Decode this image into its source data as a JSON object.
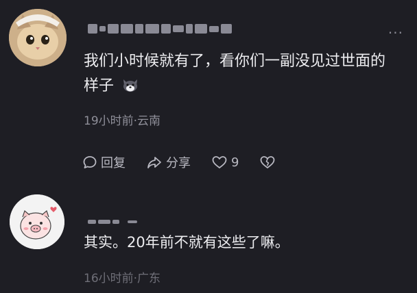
{
  "comments": [
    {
      "text": "我们小时候就有了，看你们一副没见过世面的样子",
      "emoji": "husky-face",
      "time": "19小时前",
      "location": "云南",
      "actions": {
        "reply": "回复",
        "share": "分享",
        "likes": "9"
      }
    },
    {
      "text": "其实。20年前不就有这些了嘛。",
      "time": "16小时前",
      "location": "广东"
    }
  ],
  "separator": "·",
  "colors": {
    "background": "#1e1e24",
    "text": "#ededf0",
    "meta": "#8f8f99"
  }
}
